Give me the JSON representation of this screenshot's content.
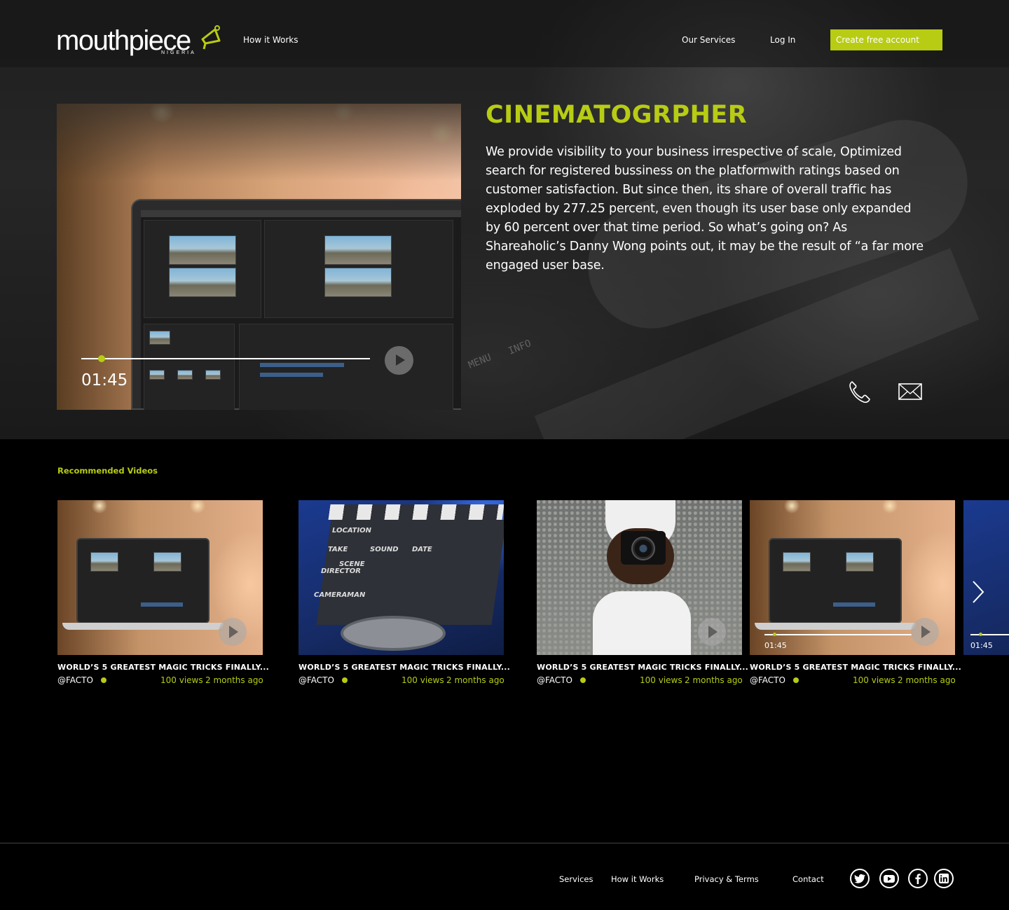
{
  "brand": {
    "logo_text": "mouthpiece",
    "logo_sub": "NIGERIA",
    "accent": "#b7cc13"
  },
  "nav": {
    "how_it_works": "How it Works",
    "our_services": "Our Services",
    "login": "Log In",
    "cta": "Create free account"
  },
  "player": {
    "time": "01:45",
    "progress": 0.06,
    "play_icon": "play-icon"
  },
  "hero": {
    "title": "CINEMATOGRPHER",
    "description": "We provide visibility to your business irrespective of scale,  Optimized search for registered bussiness on the platformwith ratings based on customer satisfaction. But since then, its share of overall traffic has exploded by 277.25 percent, even though its user base only expanded by 60 percent over that time period. So what’s going on? As Shareaholic’s Danny Wong points out, it may be the result of “a far more engaged user base.",
    "contact_icons": [
      "phone-icon",
      "mail-icon"
    ]
  },
  "recommended": {
    "title": "Recommended Videos",
    "cards": [
      {
        "title": "WORLD’S 5 GREATEST MAGIC TRICKS FINALLY...",
        "channel": "@FACTO",
        "views": "100 views",
        "ago": "2 months ago"
      },
      {
        "title": "WORLD’S 5 GREATEST MAGIC TRICKS FINALLY...",
        "channel": "@FACTO",
        "views": "100 views",
        "ago": "2 months ago"
      },
      {
        "title": "WORLD’S 5 GREATEST MAGIC TRICKS FINALLY...",
        "channel": "@FACTO",
        "views": "100 views",
        "ago": "2 months ago"
      },
      {
        "title": "WORLD’S 5 GREATEST MAGIC TRICKS FINALLY...",
        "channel": "@FACTO",
        "views": "100 views",
        "ago": "2 months ago",
        "time": "01:45"
      }
    ],
    "partial_card_time": "01:45",
    "clapper_labels": [
      "LOCATION",
      "TAKE",
      "SOUND",
      "DATE",
      "SCENE",
      "DIRECTOR",
      "CAMERAMAN"
    ],
    "hero_deco_labels": [
      "MENU",
      "INFO"
    ]
  },
  "footer": {
    "links": [
      "Services",
      "How it Works",
      "Privacy & Terms",
      "Contact"
    ],
    "social": [
      "twitter-icon",
      "youtube-icon",
      "facebook-icon",
      "linkedin-icon"
    ]
  }
}
